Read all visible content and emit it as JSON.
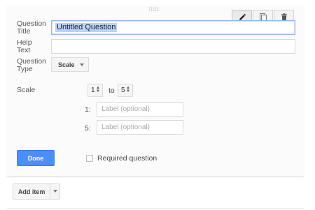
{
  "question": {
    "title_label": "Question\nTitle",
    "title_value": "Untitled Question",
    "help_label": "Help\nText",
    "help_value": "",
    "type_label": "Question\nType",
    "type_value": "Scale"
  },
  "toolbar": {
    "edit_icon": "pencil-icon",
    "duplicate_icon": "duplicate-icon",
    "delete_icon": "trash-icon"
  },
  "scale": {
    "label": "Scale",
    "from_value": "1",
    "to_text": "to",
    "to_value": "5",
    "low_prefix": "1:",
    "high_prefix": "5:",
    "label_placeholder": "Label (optional)"
  },
  "footer": {
    "done_label": "Done",
    "required_label": "Required question",
    "required_checked": false
  },
  "add_item": {
    "label": "Add item"
  },
  "colors": {
    "accent": "#4c8ef5",
    "title_selection": "#b7d4f7"
  }
}
